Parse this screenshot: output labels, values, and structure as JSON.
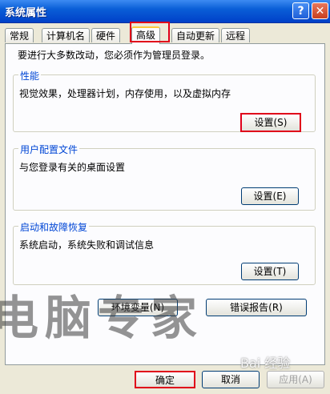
{
  "window": {
    "title": "系统属性",
    "help_label": "?",
    "close_label": "✕"
  },
  "tabs": [
    {
      "label": "常规"
    },
    {
      "label": "计算机名"
    },
    {
      "label": "硬件"
    },
    {
      "label": "高级"
    },
    {
      "label": "自动更新"
    },
    {
      "label": "远程"
    }
  ],
  "intro": "要进行大多数改动，您必须作为管理员登录。",
  "groups": {
    "performance": {
      "title": "性能",
      "desc": "视觉效果，处理器计划，内存使用，以及虚拟内存",
      "button": "设置(S)"
    },
    "profiles": {
      "title": "用户配置文件",
      "desc": "与您登录有关的桌面设置",
      "button": "设置(E)"
    },
    "startup": {
      "title": "启动和故障恢复",
      "desc": "系统启动，系统失败和调试信息",
      "button": "设置(T)"
    }
  },
  "env_button": "环境变量(N)",
  "error_button": "错误报告(R)",
  "footer": {
    "ok": "确定",
    "cancel": "取消",
    "apply": "应用(A)"
  },
  "watermark": "电脑专家",
  "baidu_mark": "Bai 经验",
  "accent": {
    "highlight": "#e0001a",
    "title_blue": "#0a5ed7",
    "group_label": "#0046d5"
  }
}
